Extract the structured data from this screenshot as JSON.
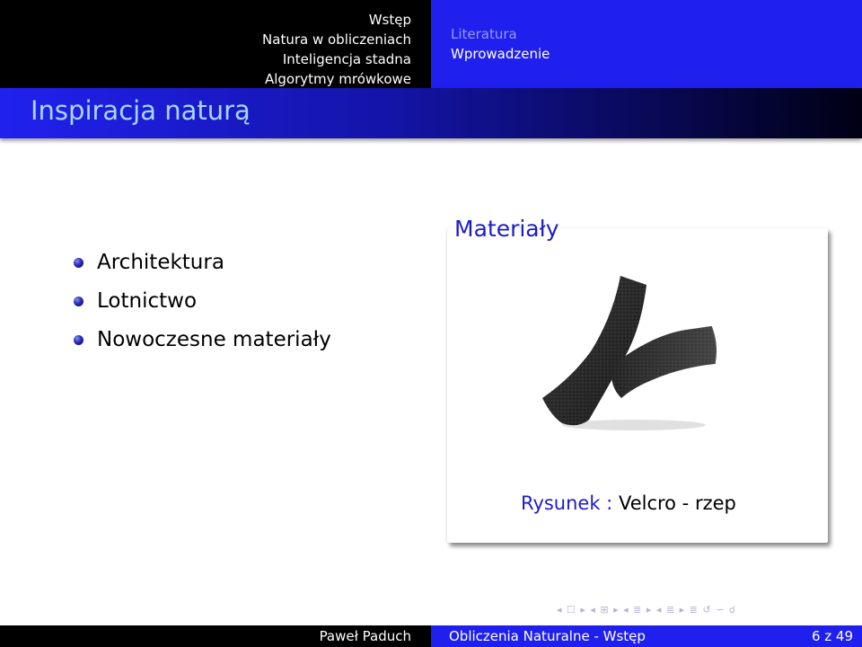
{
  "header": {
    "sections": [
      "Wstęp",
      "Natura w obliczeniach",
      "Inteligencja stadna",
      "Algorytmy mrówkowe"
    ],
    "subsections": [
      "Literatura",
      "Wprowadzenie"
    ]
  },
  "frame_title": "Inspiracja naturą",
  "bullets": [
    "Architektura",
    "Lotnictwo",
    "Nowoczesne materiały"
  ],
  "column_title": "Materiały",
  "figure": {
    "caption_label": "Rysunek :",
    "caption_text": "Velcro - rzep"
  },
  "nav_symbols": "◂ ☐ ▸ ◂ ⊞ ▸ ◂ ≣ ▸ ◂ ≣ ▸ ≣ ↺ ∽ ☌",
  "footer": {
    "author": "Paweł Paduch",
    "title": "Obliczenia Naturalne - Wstęp",
    "page": "6 z 49"
  },
  "colors": {
    "accent_blue": "#2020ee",
    "title_text": "#a8d6ff",
    "structure": "#1c1cc8"
  }
}
